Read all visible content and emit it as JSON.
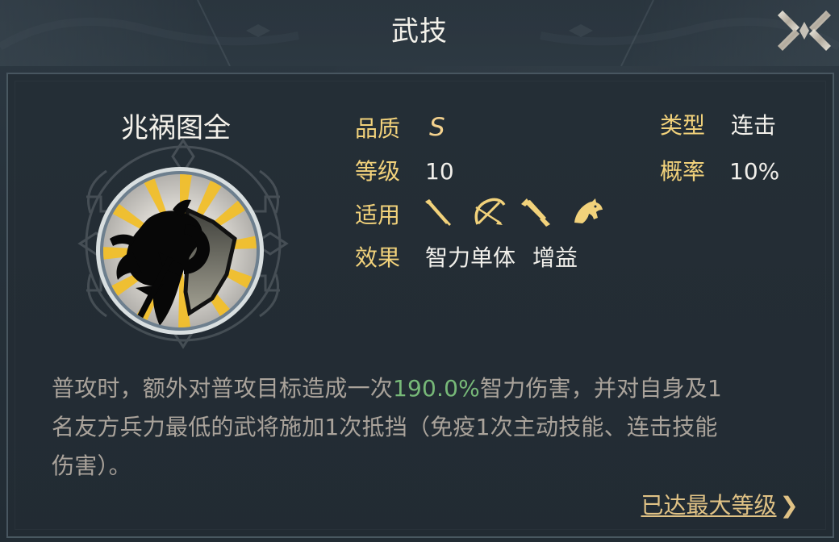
{
  "header": {
    "title": "武技"
  },
  "skill": {
    "name": "兆祸图全",
    "labels": {
      "quality": "品质",
      "level": "等级",
      "apply": "适用",
      "effect": "效果",
      "type": "类型",
      "chance": "概率"
    },
    "values": {
      "quality": "S",
      "level": "10",
      "effect_primary": "智力单体",
      "effect_secondary": "增益",
      "type": "连击",
      "chance": "10%"
    },
    "applicable_icons": [
      "sword-icon",
      "bow-icon",
      "spear-icon",
      "horse-icon"
    ]
  },
  "description": {
    "before": "普攻时，额外对普攻目标造成一次",
    "highlight": "190.0%",
    "after_line1": "智力伤害，并对自身及1",
    "line2": "名友方兵力最低的武将施加1次抵挡（免疫1次主动技能、连击技能",
    "line3": "伤害）。"
  },
  "footer": {
    "max_level_link": "已达最大等级",
    "chevron": "❯"
  },
  "colors": {
    "background": "#27323b",
    "label_gold": "#f2d27b",
    "text_light": "#f1efea",
    "text_muted": "#aaa39b",
    "highlight_green": "#77b978"
  }
}
